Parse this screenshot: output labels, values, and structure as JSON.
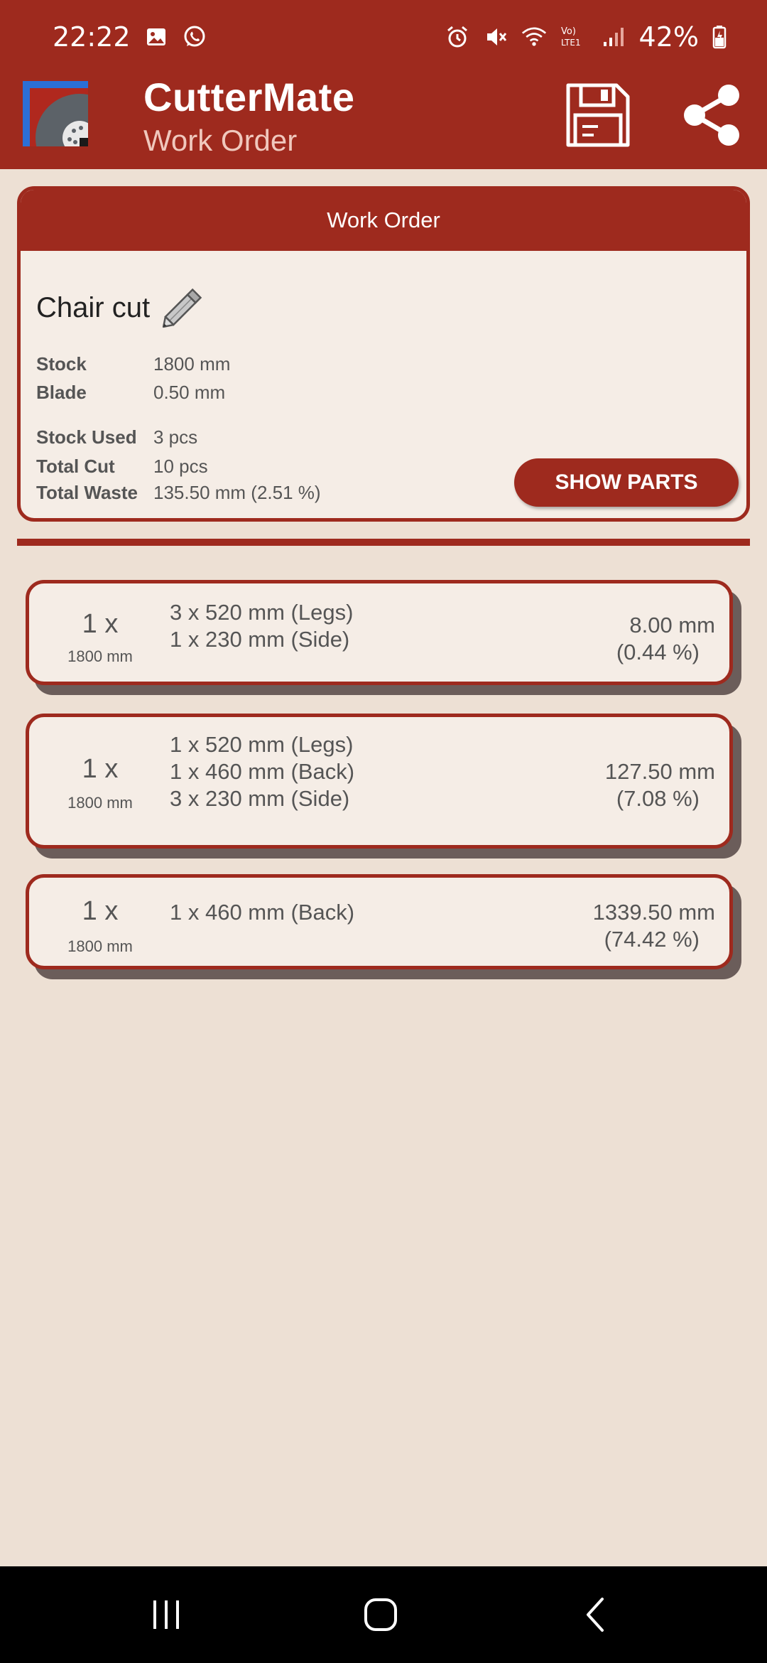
{
  "status_bar": {
    "time": "22:22",
    "battery": "42%",
    "icons": [
      "image-icon",
      "whatsapp-icon",
      "alarm-icon",
      "mute-icon",
      "wifi-icon",
      "volte-icon",
      "signal-icon",
      "battery-icon"
    ],
    "volte_label": "Vo)\nLTE1"
  },
  "app_bar": {
    "title": "CutterMate",
    "subtitle": "Work Order",
    "actions": [
      "save-icon",
      "share-icon"
    ]
  },
  "work_order": {
    "header": "Work Order",
    "name": "Chair cut",
    "stock_label": "Stock",
    "stock_value": "1800 mm",
    "blade_label": "Blade",
    "blade_value": "0.50 mm",
    "stock_used_label": "Stock Used",
    "stock_used_value": "3 pcs",
    "total_cut_label": "Total Cut",
    "total_cut_value": "10 pcs",
    "total_waste_label": "Total Waste",
    "total_waste_value": "135.50 mm (2.51 %)",
    "show_parts_label": "SHOW PARTS"
  },
  "results": [
    {
      "qty": "1 x",
      "stock": "1800 mm",
      "parts": [
        "3 x 520 mm (Legs)",
        "1 x 230 mm (Side)"
      ],
      "waste": "8.00 mm",
      "waste_pct": "(0.44 %)"
    },
    {
      "qty": "1 x",
      "stock": "1800 mm",
      "parts": [
        "1 x 520 mm (Legs)",
        "1 x 460 mm (Back)",
        "3 x 230 mm (Side)"
      ],
      "waste": "127.50 mm",
      "waste_pct": "(7.08 %)"
    },
    {
      "qty": "1 x",
      "stock": "1800 mm",
      "parts": [
        "1 x 460 mm (Back)"
      ],
      "waste": "1339.50 mm",
      "waste_pct": "(74.42 %)"
    }
  ],
  "nav_bar": {
    "buttons": [
      "recents-icon",
      "home-icon",
      "back-icon"
    ]
  },
  "colors": {
    "primary": "#9e2a1e",
    "background": "#ede0d4",
    "card": "#f5ede6"
  }
}
